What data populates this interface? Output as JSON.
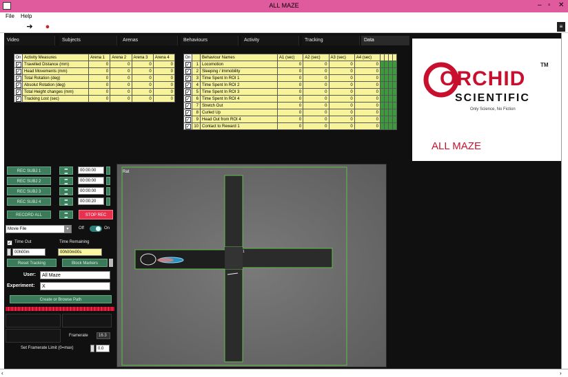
{
  "window": {
    "title": "ALL MAZE",
    "controls": [
      "–",
      "▫",
      "✕"
    ]
  },
  "menu": [
    "File",
    "Help"
  ],
  "toolbar": {
    "buttons": [
      {
        "name": "go-arrow-icon",
        "glyph": "➔"
      },
      {
        "name": "record-icon",
        "glyph": "●"
      }
    ]
  },
  "tabs": [
    {
      "label": "Video",
      "active": false
    },
    {
      "label": "Subjects",
      "active": false
    },
    {
      "label": "Arenas",
      "active": false
    },
    {
      "label": "Behaviours",
      "active": false
    },
    {
      "label": "Activity",
      "active": false
    },
    {
      "label": "Tracking",
      "active": false
    },
    {
      "label": "Data",
      "active": true
    }
  ],
  "activity": {
    "headers": [
      "On",
      "Activity Measures",
      "Arena 1",
      "Arena 2",
      "Arena 3",
      "Arena 4"
    ],
    "rows": [
      {
        "name": "Travelled Distance (mm)",
        "values": [
          "0",
          "0",
          "0",
          "0"
        ],
        "checked": true
      },
      {
        "name": "Head Movements (mm)",
        "values": [
          "0",
          "0",
          "0",
          "0"
        ],
        "checked": true
      },
      {
        "name": "Total Rotation (deg)",
        "values": [
          "0",
          "0",
          "0",
          "0"
        ],
        "checked": true
      },
      {
        "name": "Absolut Rotation (deg)",
        "values": [
          "0",
          "0",
          "0",
          "0"
        ],
        "checked": true
      },
      {
        "name": "Total Height changes (mm)",
        "values": [
          "0",
          "0",
          "0",
          "0"
        ],
        "checked": true
      },
      {
        "name": "Tracking Lost (sec)",
        "values": [
          "0",
          "0",
          "0",
          "0"
        ],
        "checked": true
      }
    ]
  },
  "behaviours": {
    "headers": [
      "On",
      "",
      "Behaviour Names",
      "A1 (sec)",
      "A2 (sec)",
      "A3 (sec)",
      "A4 (sec)"
    ],
    "rows": [
      {
        "num": "1",
        "name": "Locomotion",
        "values": [
          "0",
          "0",
          "0",
          "0"
        ],
        "checked": true
      },
      {
        "num": "2",
        "name": "Sleeping / Immobility",
        "values": [
          "0",
          "0",
          "0",
          "0"
        ],
        "checked": true
      },
      {
        "num": "3",
        "name": "Time Spent In ROI 1",
        "values": [
          "0",
          "0",
          "0",
          "0"
        ],
        "checked": true
      },
      {
        "num": "4",
        "name": "Time Spent In ROI 2",
        "values": [
          "0",
          "0",
          "0",
          "0"
        ],
        "checked": true
      },
      {
        "num": "5",
        "name": "Time Spent In ROI 3",
        "values": [
          "0",
          "0",
          "0",
          "0"
        ],
        "checked": true
      },
      {
        "num": "6",
        "name": "Time Spent In ROI 4",
        "values": [
          "0",
          "0",
          "0",
          "0"
        ],
        "checked": true
      },
      {
        "num": "7",
        "name": "Stretch Out",
        "values": [
          "0",
          "0",
          "0",
          "0"
        ],
        "checked": true
      },
      {
        "num": "8",
        "name": "Curled Up",
        "values": [
          "0",
          "0",
          "0",
          "0"
        ],
        "checked": true
      },
      {
        "num": "9",
        "name": "Head Out from ROI 4",
        "values": [
          "0",
          "0",
          "0",
          "0"
        ],
        "checked": true
      },
      {
        "num": "10",
        "name": "Contact to Reward 1",
        "values": [
          "0",
          "0",
          "0",
          "0"
        ],
        "checked": true
      }
    ]
  },
  "logo": {
    "tm": "TM",
    "brand": "ORCHID",
    "sub": "SCIENTIFIC",
    "tagline": "Only Science, No Fiction",
    "app": "ALL MAZE",
    "accent": "#c8102e"
  },
  "recording": {
    "subjects": [
      {
        "label": "REC SUBJ 1",
        "time": "00:00:00"
      },
      {
        "label": "REC SUBJ 2",
        "time": "00:00:00"
      },
      {
        "label": "REC SUBJ 3",
        "time": "00:00:00"
      },
      {
        "label": "REC SUBJ 4",
        "time": "00:00:20"
      }
    ],
    "record_all": "RECORD ALL",
    "stop_rec": "STOP REC",
    "source": "Movie File",
    "off_label": "Off",
    "on_label": "On",
    "time_out_label": "Time Out",
    "time_remaining_label": "Time Remaining",
    "time_out_value": "00h00m",
    "time_remaining_value": "00h00m00s",
    "reset_tracking": "Reset Tracking",
    "block_markers": "Block Markers",
    "user_label": "User:",
    "user_value": "All Maze",
    "experiment_label": "Experiment:",
    "experiment_value": "X",
    "create_path": "Create or Browse Path",
    "framerate_label": "Framerate",
    "framerate_value": "16.3",
    "fr_limit_label": "Set Framerate Limit (0=max)",
    "fr_limit_value": "0.0"
  },
  "video": {
    "label": "Rat",
    "arena_color": "#5fbf4a",
    "marker": "1"
  }
}
